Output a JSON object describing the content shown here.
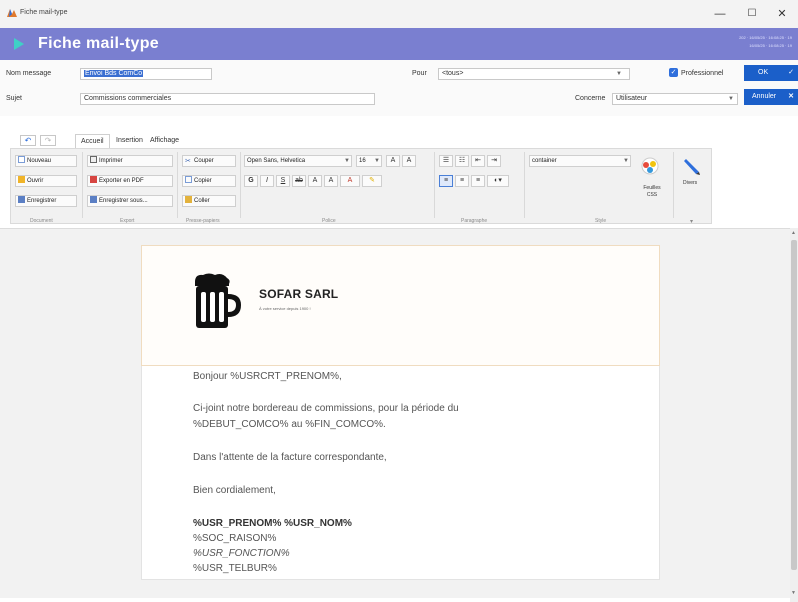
{
  "window": {
    "title": "Fiche mail-type",
    "min": "—",
    "max": "☐",
    "close": "✕"
  },
  "header": {
    "title": "Fiche mail-type",
    "meta_line1": "202 · 16/05/25 · 16:08:25 · 19",
    "meta_line2": "16/05/25 · 16:08:25 · 19"
  },
  "form": {
    "nom_label": "Nom message",
    "nom_value": "Envoi Bds ComCo",
    "pour_label": "Pour",
    "pour_value": "<tous>",
    "professionnel_label": "Professionnel",
    "ok_label": "OK",
    "sujet_label": "Sujet",
    "sujet_value": "Commissions commerciales",
    "concerne_label": "Concerne",
    "concerne_value": "Utilisateur",
    "annuler_label": "Annuler"
  },
  "ribbon": {
    "tabs": [
      "Accueil",
      "Insertion",
      "Affichage"
    ],
    "document": {
      "label": "Document",
      "nouveau": "Nouveau",
      "ouvrir": "Ouvrir",
      "enregistrer": "Enregistrer"
    },
    "export": {
      "label": "Export",
      "imprimer": "Imprimer",
      "pdf": "Exporter en PDF",
      "sous": "Enregistrer sous..."
    },
    "presse": {
      "label": "Presse-papiers",
      "couper": "Couper",
      "copier": "Copier",
      "coller": "Coller"
    },
    "police": {
      "label": "Police",
      "font": "Open Sans, Helvetica",
      "size": "16"
    },
    "paragraphe": {
      "label": "Paragraphe"
    },
    "style": {
      "label": "Style",
      "value": "container",
      "feuilles": "Feuilles CSS",
      "divers": "Divers"
    }
  },
  "document": {
    "company": "SOFAR SARL",
    "tagline": "À votre service depuis 1900 !",
    "lines": [
      "Bonjour %USRCRT_PRENOM%,",
      "Ci-joint notre bordereau de commissions, pour la période du",
      "%DEBUT_COMCO% au %FIN_COMCO%.",
      "Dans l'attente de la facture correspondante,",
      "Bien cordialement,",
      "%USR_PRENOM% %USR_NOM%",
      "%SOC_RAISON%",
      "%USR_FONCTION%",
      "%USR_TELBUR%"
    ]
  },
  "colors": {
    "header": "#7a7fd0",
    "accent": "#3fd1c6",
    "button": "#1b5fc9"
  }
}
